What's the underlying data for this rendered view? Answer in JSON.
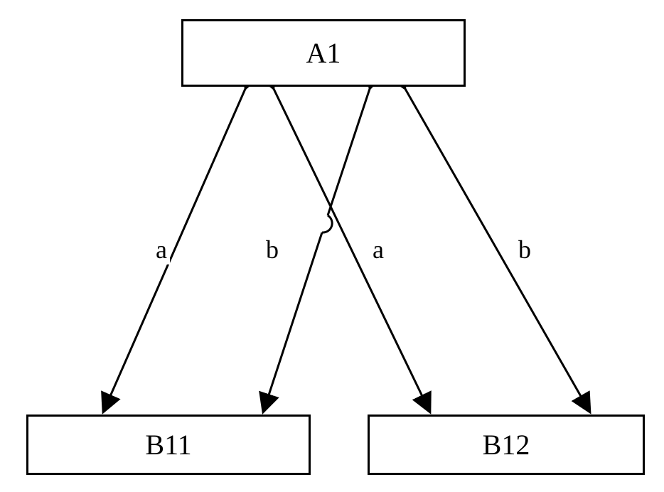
{
  "nodes": {
    "top": "A1",
    "bottomLeft": "B11",
    "bottomRight": "B12"
  },
  "edges": {
    "label_a1": "a",
    "label_b1": "b",
    "label_a2": "a",
    "label_b2": "b"
  }
}
